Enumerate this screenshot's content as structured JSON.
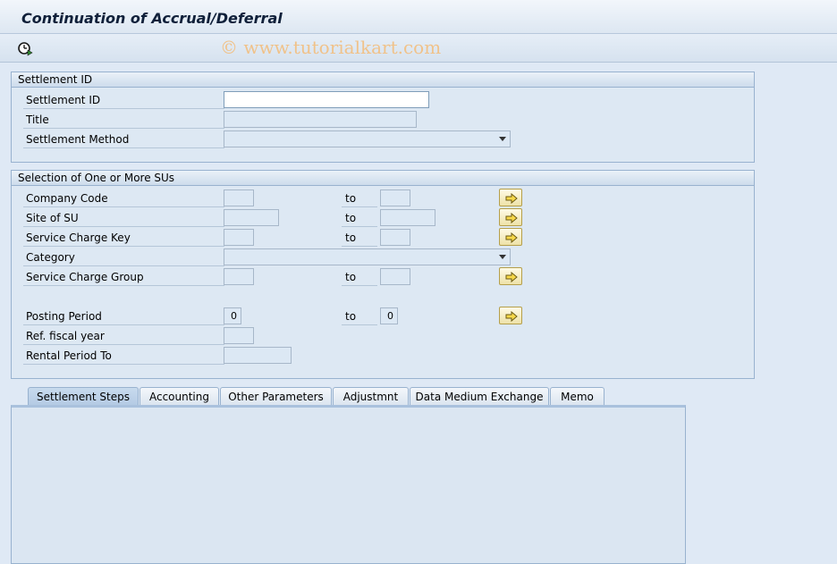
{
  "window": {
    "title": "Continuation of Accrual/Deferral"
  },
  "toolbar": {
    "watermark": "© www.tutorialkart.com"
  },
  "settlement_group": {
    "title": "Settlement ID",
    "settlement_id_label": "Settlement ID",
    "settlement_id_value": "",
    "title_label": "Title",
    "title_value": "",
    "method_label": "Settlement Method",
    "method_value": ""
  },
  "selection_group": {
    "title": "Selection of One or More SUs",
    "to_label": "to",
    "company_code_label": "Company Code",
    "site_label": "Site of SU",
    "service_charge_key_label": "Service Charge Key",
    "category_label": "Category",
    "service_charge_group_label": "Service Charge Group",
    "posting_period_label": "Posting Period",
    "posting_period_from": "0",
    "posting_period_to": "0",
    "ref_fiscal_year_label": "Ref. fiscal year",
    "rental_period_to_label": "Rental Period To"
  },
  "tabs": [
    {
      "label": "Settlement Steps",
      "active": true
    },
    {
      "label": "Accounting",
      "active": false
    },
    {
      "label": "Other Parameters",
      "active": false
    },
    {
      "label": "Adjustmnt",
      "active": false
    },
    {
      "label": "Data Medium Exchange",
      "active": false
    },
    {
      "label": "Memo",
      "active": false
    }
  ],
  "icons": {
    "execute": "execute-clock-icon",
    "multiple_selection": "multiple-selection-arrow-icon"
  },
  "colors": {
    "background": "#dfe9f5",
    "group_border": "#98b2cf",
    "watermark": "#f0c28a"
  }
}
